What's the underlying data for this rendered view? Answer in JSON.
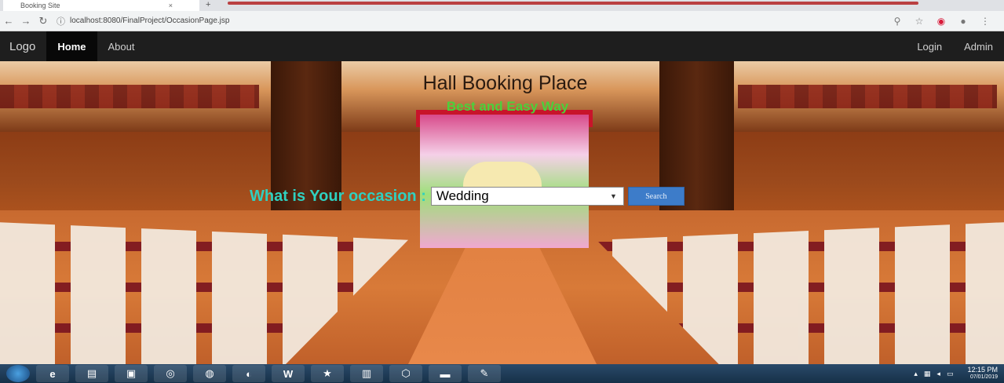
{
  "browser": {
    "tab_title": "Booking Site",
    "tab_close": "×",
    "new_tab": "+",
    "url": "localhost:8080/FinalProject/OccasionPage.jsp",
    "icons": [
      "back-arrow-icon",
      "forward-arrow-icon",
      "reload-icon",
      "info-icon",
      "zoom-icon",
      "star-icon",
      "extension-icon",
      "profile-icon",
      "menu-icon"
    ]
  },
  "navbar": {
    "logo": "Logo",
    "items": [
      {
        "label": "Home",
        "active": true
      },
      {
        "label": "About",
        "active": false
      }
    ],
    "right_items": [
      {
        "label": "Login"
      },
      {
        "label": "Admin"
      }
    ]
  },
  "hero": {
    "title": "Hall Booking Place",
    "subtitle": "Best and Easy Way",
    "occasion_label": "What is Your occasion :",
    "occasion_selected": "Wedding",
    "search_label": "Search"
  },
  "taskbar": {
    "apps": [
      "ie-icon",
      "explorer-icon",
      "media-icon",
      "chrome-icon",
      "firefox-icon",
      "eclipse-icon",
      "word-icon",
      "star-app-icon",
      "office-icon",
      "virtualbox-icon",
      "terminal-icon",
      "paint-icon"
    ],
    "time": "12:15 PM",
    "date": "07/01/2019"
  },
  "colors": {
    "navbar_bg": "#1e1e1e",
    "subtitle": "#4bd13b",
    "occasion_label": "#2fd0c0",
    "search_button": "#3d7cc9"
  }
}
